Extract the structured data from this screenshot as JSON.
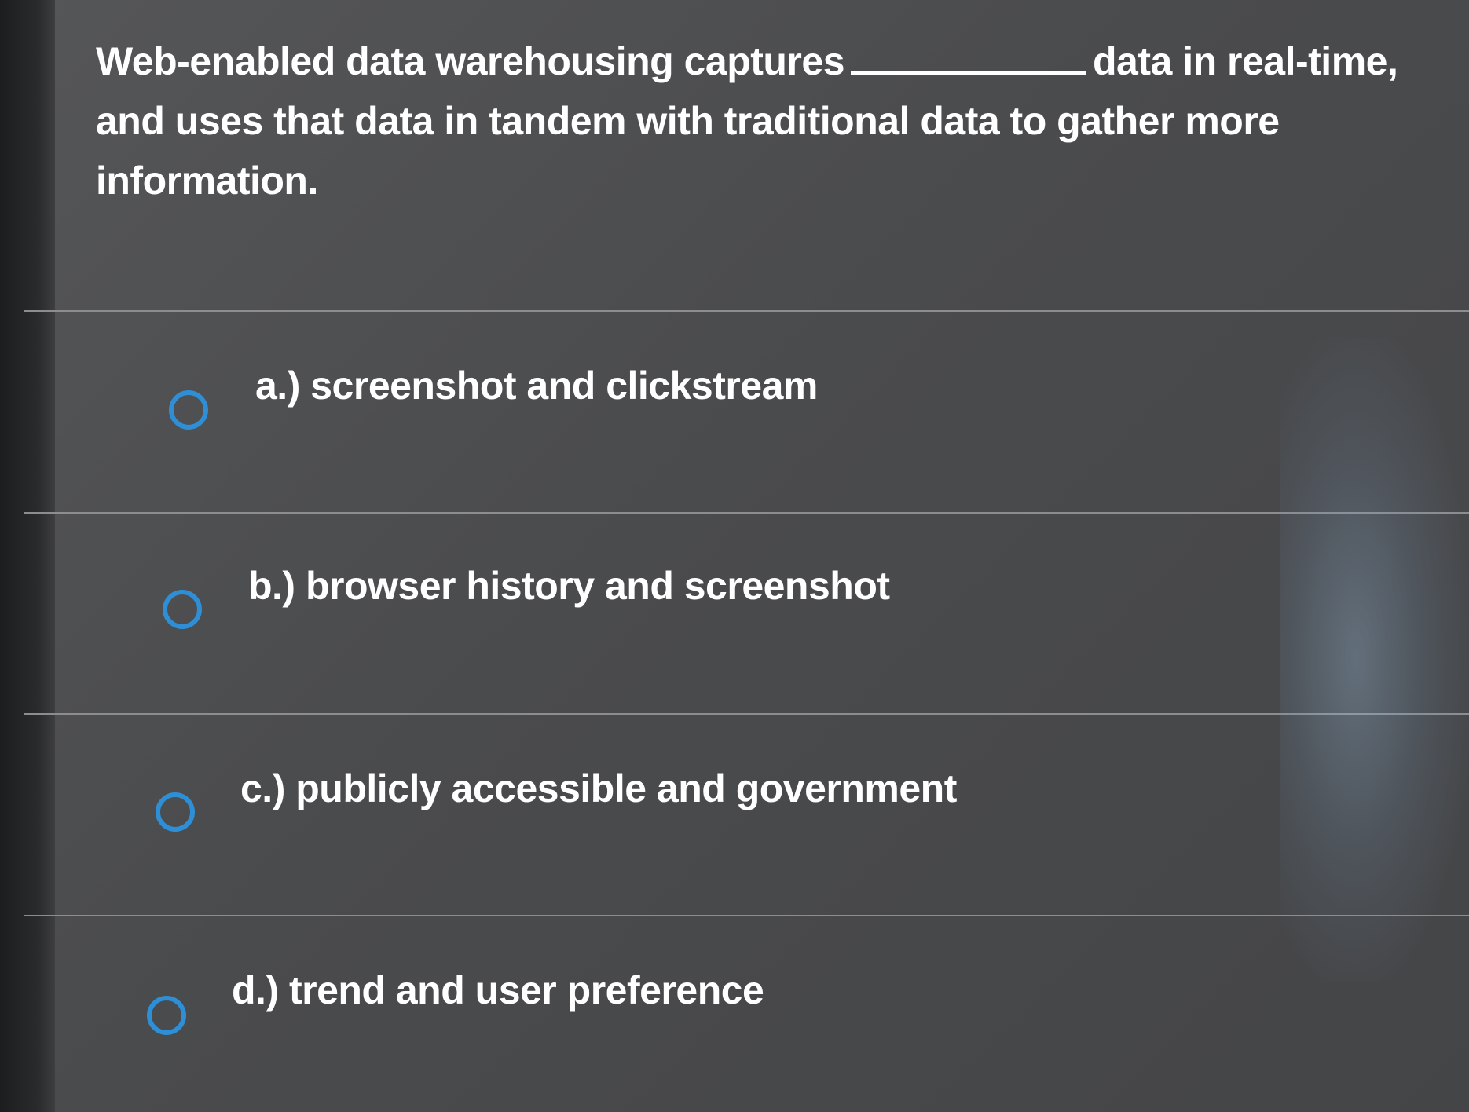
{
  "question": {
    "text_before_blank": "Web-enabled data warehousing captures",
    "text_after_blank": "data in real-time, and uses that data in tandem with traditional data to gather more information."
  },
  "options": [
    {
      "label": "a.) screenshot and clickstream"
    },
    {
      "label": "b.) browser history and screenshot"
    },
    {
      "label": "c.) publicly accessible and government"
    },
    {
      "label": "d.) trend and user preference"
    }
  ],
  "colors": {
    "background": "#4f5052",
    "text": "#ffffff",
    "radio_accent": "#2e8fd6",
    "divider": "#8c8d90"
  }
}
